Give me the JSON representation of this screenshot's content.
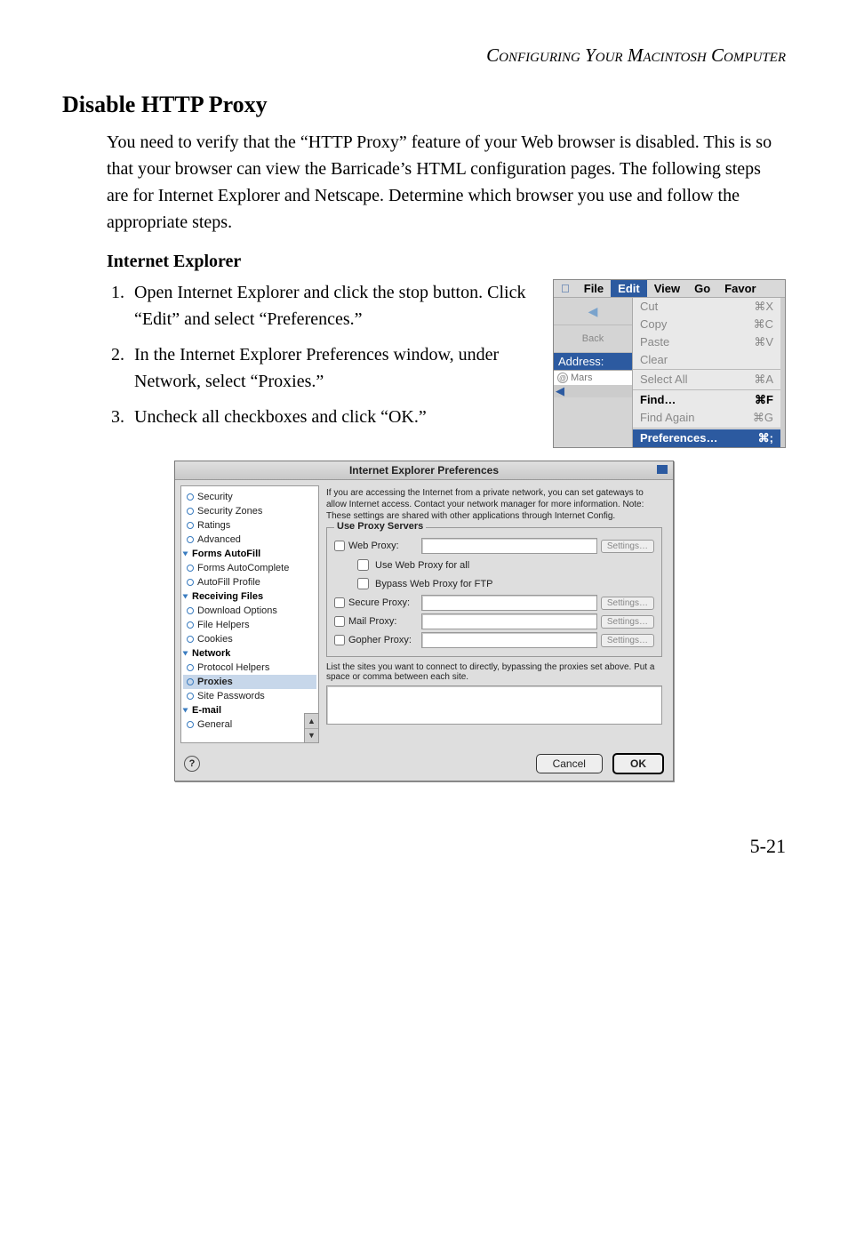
{
  "header": {
    "section_title": "Configuring Your Macintosh Computer"
  },
  "section": {
    "title": "Disable HTTP Proxy",
    "intro": "You need to verify that the “HTTP Proxy” feature of your Web browser is disabled. This is so that your browser can view the Barricade’s HTML configuration pages. The following steps are for Internet Explorer and Netscape. Determine which browser you use and follow the appropriate steps.",
    "subsection": "Internet Explorer",
    "steps": [
      "Open Internet Explorer and click the stop button. Click “Edit” and select “Preferences.”",
      "In the Internet Explorer Preferences window, under Network, select “Proxies.”",
      "Uncheck all checkboxes and click “OK.”"
    ]
  },
  "edit_menu": {
    "menubar": {
      "file": "File",
      "edit": "Edit",
      "view": "View",
      "go": "Go",
      "favor": "Favor"
    },
    "toolbar": {
      "back": "Back",
      "address": "Address:",
      "mars": "Mars"
    },
    "items": {
      "cut": {
        "label": "Cut",
        "shortcut": "⌘X"
      },
      "copy": {
        "label": "Copy",
        "shortcut": "⌘C"
      },
      "paste": {
        "label": "Paste",
        "shortcut": "⌘V"
      },
      "clear": {
        "label": "Clear",
        "shortcut": ""
      },
      "select_all": {
        "label": "Select All",
        "shortcut": "⌘A"
      },
      "find": {
        "label": "Find…",
        "shortcut": "⌘F"
      },
      "find_again": {
        "label": "Find Again",
        "shortcut": "⌘G"
      },
      "preferences": {
        "label": "Preferences…",
        "shortcut": "⌘;"
      }
    }
  },
  "prefs": {
    "title": "Internet Explorer Preferences",
    "sidebar": {
      "web_browser_items": {
        "security": "Security",
        "security_zones": "Security Zones",
        "ratings": "Ratings",
        "advanced": "Advanced"
      },
      "forms_autofill_header": "Forms AutoFill",
      "forms_autofill_items": {
        "forms_autocomplete": "Forms AutoComplete",
        "autofill_profile": "AutoFill Profile"
      },
      "receiving_files_header": "Receiving Files",
      "receiving_files_items": {
        "download_options": "Download Options",
        "file_helpers": "File Helpers",
        "cookies": "Cookies"
      },
      "network_header": "Network",
      "network_items": {
        "protocol_helpers": "Protocol Helpers",
        "proxies": "Proxies",
        "site_passwords": "Site Passwords"
      },
      "email_header": "E-mail",
      "email_items": {
        "general": "General"
      }
    },
    "desc": "If you are accessing the Internet from a private network, you can set gateways to allow Internet access. Contact your network manager for more information. Note: These settings are shared with other applications through Internet Config.",
    "use_proxy_legend": "Use Proxy Servers",
    "labels": {
      "web_proxy": "Web Proxy:",
      "use_web_all": "Use Web Proxy for all",
      "bypass_ftp": "Bypass Web Proxy for FTP",
      "secure_proxy": "Secure Proxy:",
      "mail_proxy": "Mail Proxy:",
      "gopher_proxy": "Gopher Proxy:",
      "settings": "Settings…"
    },
    "bypass_desc": "List the sites you want to connect to directly, bypassing the proxies set above. Put a space or comma between each site.",
    "buttons": {
      "cancel": "Cancel",
      "ok": "OK"
    },
    "help": "?"
  },
  "page_number": "5-21"
}
